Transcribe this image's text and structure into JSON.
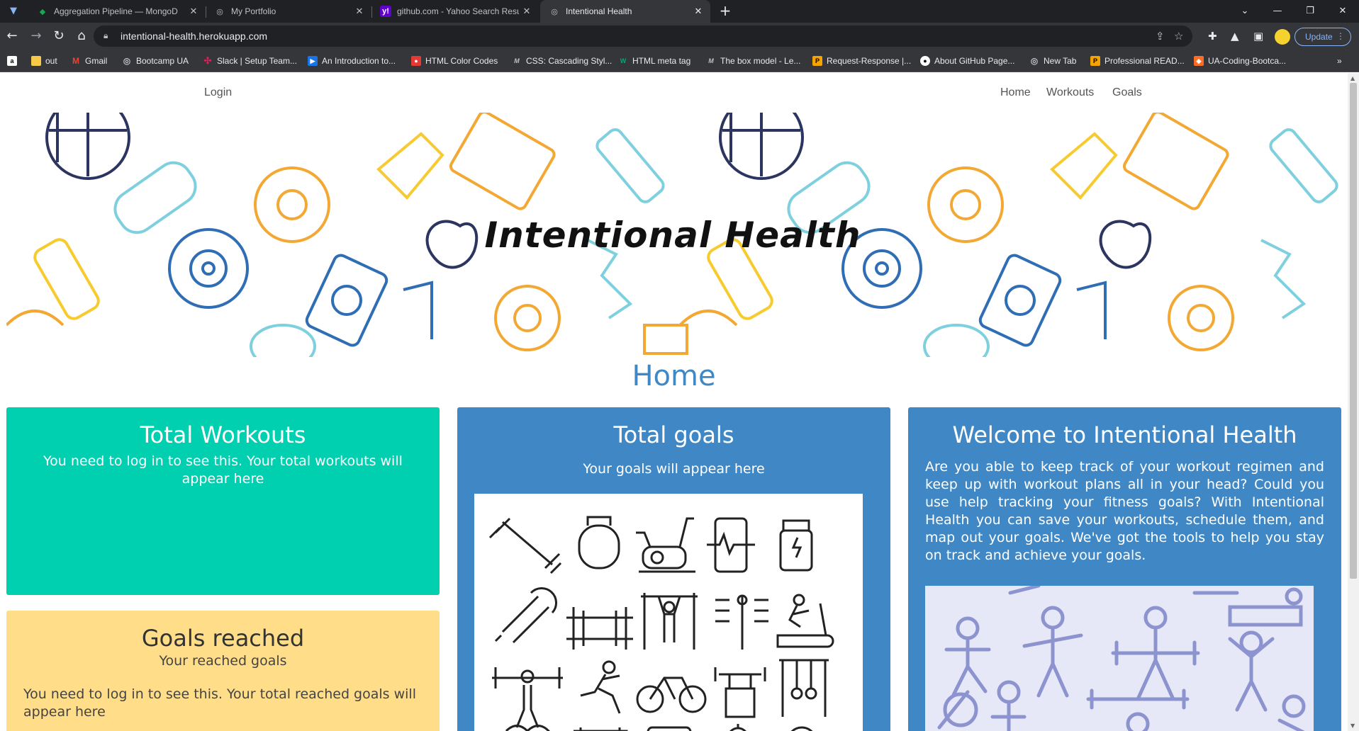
{
  "browser": {
    "tabs": [
      {
        "title": "Aggregation Pipeline — MongoD",
        "favicon": "mongodb-leaf-icon"
      },
      {
        "title": "My Portfolio",
        "favicon": "globe-icon"
      },
      {
        "title": "github.com - Yahoo Search Resu",
        "favicon": "yahoo-icon"
      },
      {
        "title": "Intentional Health",
        "favicon": "globe-icon",
        "active": true
      }
    ],
    "url": "intentional-health.herokuapp.com",
    "update_label": "Update",
    "bookmarks": [
      {
        "label": "out",
        "icon": "folder-icon"
      },
      {
        "label": "Gmail",
        "icon": "gmail-icon"
      },
      {
        "label": "Bootcamp UA",
        "icon": "globe-icon"
      },
      {
        "label": "Slack | Setup Team...",
        "icon": "slack-icon"
      },
      {
        "label": "An Introduction to...",
        "icon": "play-icon"
      },
      {
        "label": "HTML Color Codes",
        "icon": "color-icon"
      },
      {
        "label": "CSS: Cascading Styl...",
        "icon": "mdn-icon"
      },
      {
        "label": "HTML meta tag",
        "icon": "w3-icon"
      },
      {
        "label": "The box model - Le...",
        "icon": "mdn-icon"
      },
      {
        "label": "Request-Response |...",
        "icon": "doc-icon"
      },
      {
        "label": "About GitHub Page...",
        "icon": "github-icon"
      },
      {
        "label": "New Tab",
        "icon": "globe-icon"
      },
      {
        "label": "Professional READ...",
        "icon": "doc-icon"
      },
      {
        "label": "UA-Coding-Bootca...",
        "icon": "gitlab-icon"
      }
    ]
  },
  "nav": {
    "login": "Login",
    "links": [
      "Home",
      "Workouts",
      "Goals"
    ]
  },
  "hero": {
    "title": "Intentional Health"
  },
  "page_title": "Home",
  "cards": {
    "total_workouts": {
      "title": "Total Workouts",
      "message": "You need to log in to see this. Your total workouts will appear here"
    },
    "total_goals": {
      "title": "Total goals",
      "message": "Your goals will appear here"
    },
    "welcome": {
      "title": "Welcome to Intentional Health",
      "body": "Are you able to keep track of your workout regimen and keep up with workout plans all in your head? Could you use help tracking your fitness goals? With Intentional Health you can save your workouts, schedule them, and map out your goals. We've got the tools to help you stay on track and achieve your goals."
    },
    "goals_reached": {
      "title": "Goals reached",
      "subtitle": "Your reached goals",
      "message": "You need to log in to see this. Your total reached goals will appear here"
    }
  },
  "colors": {
    "workouts_card": "#00cfb0",
    "blue_card": "#3f88c5",
    "goals_reached_card": "#ffdd89",
    "title_blue": "#3f88c5"
  }
}
